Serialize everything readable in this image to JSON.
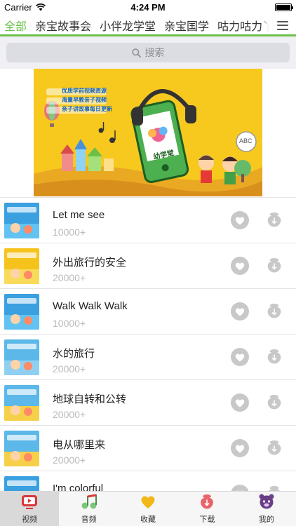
{
  "status_bar": {
    "carrier": "Carrier",
    "time": "4:24 PM",
    "battery_level": 1.0
  },
  "category_tabs": [
    {
      "label": "全部",
      "active": true
    },
    {
      "label": "亲宝故事会",
      "active": false
    },
    {
      "label": "小伴龙学堂",
      "active": false
    },
    {
      "label": "亲宝国学",
      "active": false
    },
    {
      "label": "咕力咕力丫咿",
      "active": false
    }
  ],
  "search": {
    "placeholder": "搜索",
    "icon": "search-icon"
  },
  "banner": {
    "lines": [
      "优质学前视频资源",
      "海量早教亲子视频",
      "亲子讲故事每日更新"
    ],
    "app_name": "幼学堂",
    "badge": "ABC"
  },
  "videos": [
    {
      "title": "Let me see",
      "count": "10000+"
    },
    {
      "title": "外出旅行的安全",
      "count": "20000+"
    },
    {
      "title": "Walk Walk Walk",
      "count": "10000+"
    },
    {
      "title": "水的旅行",
      "count": "20000+"
    },
    {
      "title": "地球自转和公转",
      "count": "20000+"
    },
    {
      "title": "电从哪里来",
      "count": "20000+"
    },
    {
      "title": "I'm colorful",
      "count": ""
    }
  ],
  "bottom_tabs": [
    {
      "label": "视频",
      "icon": "tv-icon",
      "active": true
    },
    {
      "label": "音频",
      "icon": "music-note-icon",
      "active": false
    },
    {
      "label": "收藏",
      "icon": "heart-icon",
      "active": false
    },
    {
      "label": "下载",
      "icon": "download-icon",
      "active": false
    },
    {
      "label": "我的",
      "icon": "bear-icon",
      "active": false
    }
  ],
  "colors": {
    "accent_green": "#6cc04a",
    "banner_yellow": "#f7c91f",
    "tab_red": "#d9373a",
    "icon_gray": "#c8c8c8"
  }
}
